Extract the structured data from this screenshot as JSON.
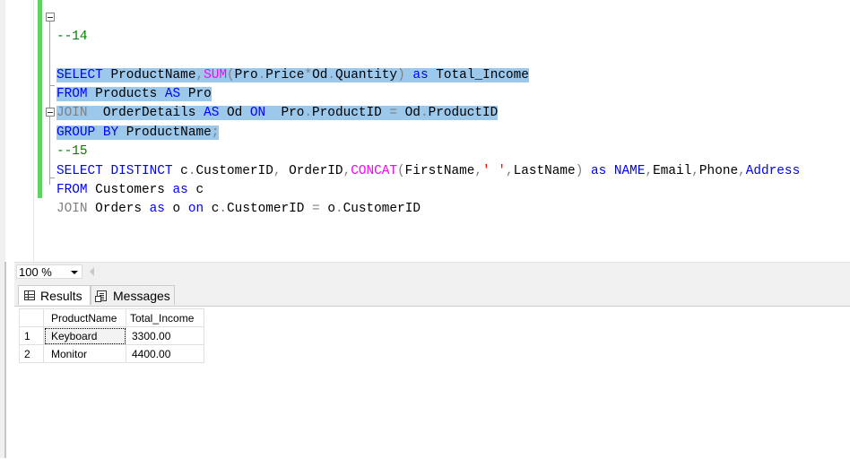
{
  "editor": {
    "line_number_partial": "--14",
    "lines": [
      {
        "segments": [
          [
            "kw",
            "SELECT"
          ],
          [
            "txt",
            " ProductName"
          ],
          [
            "op",
            ","
          ],
          [
            "fn",
            "SUM"
          ],
          [
            "op",
            "("
          ],
          [
            "txt",
            "Pro"
          ],
          [
            "op",
            "."
          ],
          [
            "txt",
            "Price"
          ],
          [
            "op",
            "*"
          ],
          [
            "txt",
            "Od"
          ],
          [
            "op",
            "."
          ],
          [
            "txt",
            "Quantity"
          ],
          [
            "op",
            ")"
          ],
          [
            "txt",
            " "
          ],
          [
            "kw",
            "as"
          ],
          [
            "txt",
            " Total_Income"
          ]
        ],
        "highlight": true
      },
      {
        "segments": [
          [
            "kw",
            "FROM"
          ],
          [
            "txt",
            " Products "
          ],
          [
            "kw",
            "AS"
          ],
          [
            "txt",
            " Pro"
          ]
        ],
        "highlight": true
      },
      {
        "segments": [
          [
            "gr",
            "JOIN"
          ],
          [
            "txt",
            "  OrderDetails "
          ],
          [
            "kw",
            "AS"
          ],
          [
            "txt",
            " Od "
          ],
          [
            "kw",
            "ON"
          ],
          [
            "txt",
            "  Pro"
          ],
          [
            "op",
            "."
          ],
          [
            "txt",
            "ProductID "
          ],
          [
            "op",
            "="
          ],
          [
            "txt",
            " Od"
          ],
          [
            "op",
            "."
          ],
          [
            "txt",
            "ProductID"
          ]
        ],
        "highlight": true
      },
      {
        "segments": [
          [
            "kw",
            "GROUP BY"
          ],
          [
            "txt",
            " ProductName"
          ],
          [
            "op",
            ";"
          ]
        ],
        "highlight": true
      },
      {
        "segments": [
          [
            "cm",
            "--15"
          ]
        ],
        "highlight": false
      },
      {
        "segments": [
          [
            "kw",
            "SELECT DISTINCT"
          ],
          [
            "txt",
            " c"
          ],
          [
            "op",
            "."
          ],
          [
            "txt",
            "CustomerID"
          ],
          [
            "op",
            ","
          ],
          [
            "txt",
            " OrderID"
          ],
          [
            "op",
            ","
          ],
          [
            "fn",
            "CONCAT"
          ],
          [
            "op",
            "("
          ],
          [
            "txt",
            "FirstName"
          ],
          [
            "op",
            ","
          ],
          [
            "str",
            "' '"
          ],
          [
            "op",
            ","
          ],
          [
            "txt",
            "LastName"
          ],
          [
            "op",
            ")"
          ],
          [
            "txt",
            " "
          ],
          [
            "kw",
            "as"
          ],
          [
            "txt",
            " "
          ],
          [
            "kw",
            "NAME"
          ],
          [
            "op",
            ","
          ],
          [
            "txt",
            "Email"
          ],
          [
            "op",
            ","
          ],
          [
            "txt",
            "Phone"
          ],
          [
            "op",
            ","
          ],
          [
            "kw",
            "Address"
          ]
        ],
        "highlight": false
      },
      {
        "segments": [
          [
            "kw",
            "FROM"
          ],
          [
            "txt",
            " Customers "
          ],
          [
            "kw",
            "as"
          ],
          [
            "txt",
            " c"
          ]
        ],
        "highlight": false
      },
      {
        "segments": [
          [
            "gr",
            "JOIN"
          ],
          [
            "txt",
            " Orders "
          ],
          [
            "kw",
            "as"
          ],
          [
            "txt",
            " o "
          ],
          [
            "kw",
            "on"
          ],
          [
            "txt",
            " c"
          ],
          [
            "op",
            "."
          ],
          [
            "txt",
            "CustomerID "
          ],
          [
            "op",
            "="
          ],
          [
            "txt",
            " o"
          ],
          [
            "op",
            "."
          ],
          [
            "txt",
            "CustomerID"
          ]
        ],
        "highlight": false
      }
    ]
  },
  "zoom": {
    "value": "100 %"
  },
  "tabs": {
    "results": "Results",
    "messages": "Messages"
  },
  "grid": {
    "columns": [
      "ProductName",
      "Total_Income"
    ],
    "rows": [
      {
        "n": "1",
        "product": "Keyboard",
        "income": "3300.00"
      },
      {
        "n": "2",
        "product": "Monitor",
        "income": "4400.00"
      }
    ]
  }
}
